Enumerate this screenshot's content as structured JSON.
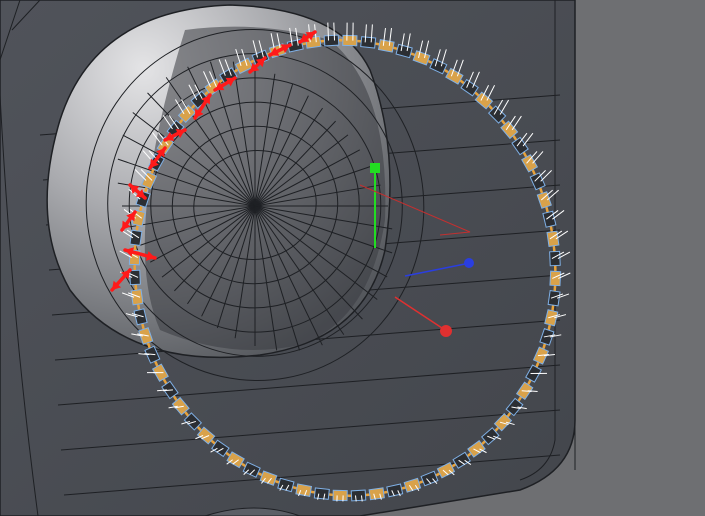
{
  "viewport": {
    "background_color": "#6e6f72",
    "panel_color": "#4a4d53",
    "wire_color": "#1e2024",
    "selection_color": "#e8a23a",
    "tooth_edge_color": "#7fb0e6",
    "normal_color": "#ffffff",
    "annotation_color": "#ff1a1a"
  },
  "ring": {
    "tooth_count": 72,
    "description_icon": "ring-gear-icon"
  },
  "annotations": {
    "arrow_count": 11,
    "icon": "double-arrow-icon"
  },
  "gizmo": {
    "axis_y_color": "#22dd22",
    "axis_x_color": "#e03030",
    "axis_z_color": "#2a3ee0",
    "icon": "transform-gizmo-icon"
  }
}
